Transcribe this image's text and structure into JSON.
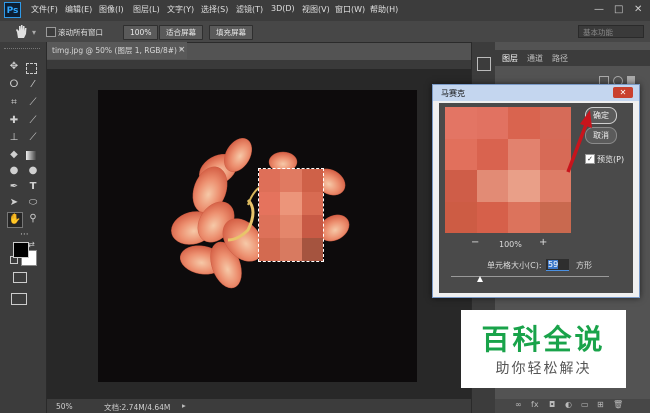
{
  "app": {
    "logo": "Ps"
  },
  "menu": {
    "items": [
      "文件(F)",
      "编辑(E)",
      "图像(I)",
      "图层(L)",
      "文字(Y)",
      "选择(S)",
      "滤镜(T)",
      "3D(D)",
      "视图(V)",
      "窗口(W)",
      "帮助(H)"
    ]
  },
  "window_controls": {
    "minimize": "—",
    "restore": "□",
    "close": "✕"
  },
  "options": {
    "scroll_all_label": "滚动所有窗口",
    "zoom_value": "100%",
    "fit_screen": "适合屏幕",
    "fill_screen": "填充屏幕",
    "workspace": "基本功能"
  },
  "document": {
    "tab_title": "timg.jpg @ 50% (图层 1, RGB/8#) *",
    "close": "×"
  },
  "status": {
    "zoom": "50%",
    "doc_size": "文档:2.74M/4.64M"
  },
  "panels": {
    "tabs": [
      "图层",
      "通道",
      "路径"
    ]
  },
  "dialog": {
    "title": "马赛克",
    "close": "✕",
    "ok": "确定",
    "cancel": "取消",
    "preview_label": "预览(P)",
    "zoom_value": "100%",
    "cell_size_label": "单元格大小(C):",
    "cell_size_value": "59",
    "cell_size_unit": "方形",
    "zoom_out_icon": "−",
    "zoom_in_icon": "+"
  },
  "watermark": {
    "title": "百科全说",
    "subtitle": "助你轻松解决"
  },
  "colors": {
    "accent_blue": "#5b8dd6",
    "watermark_green": "#19a34a",
    "arrow_red": "#c8141c",
    "flower_base": "#e87d5e"
  }
}
